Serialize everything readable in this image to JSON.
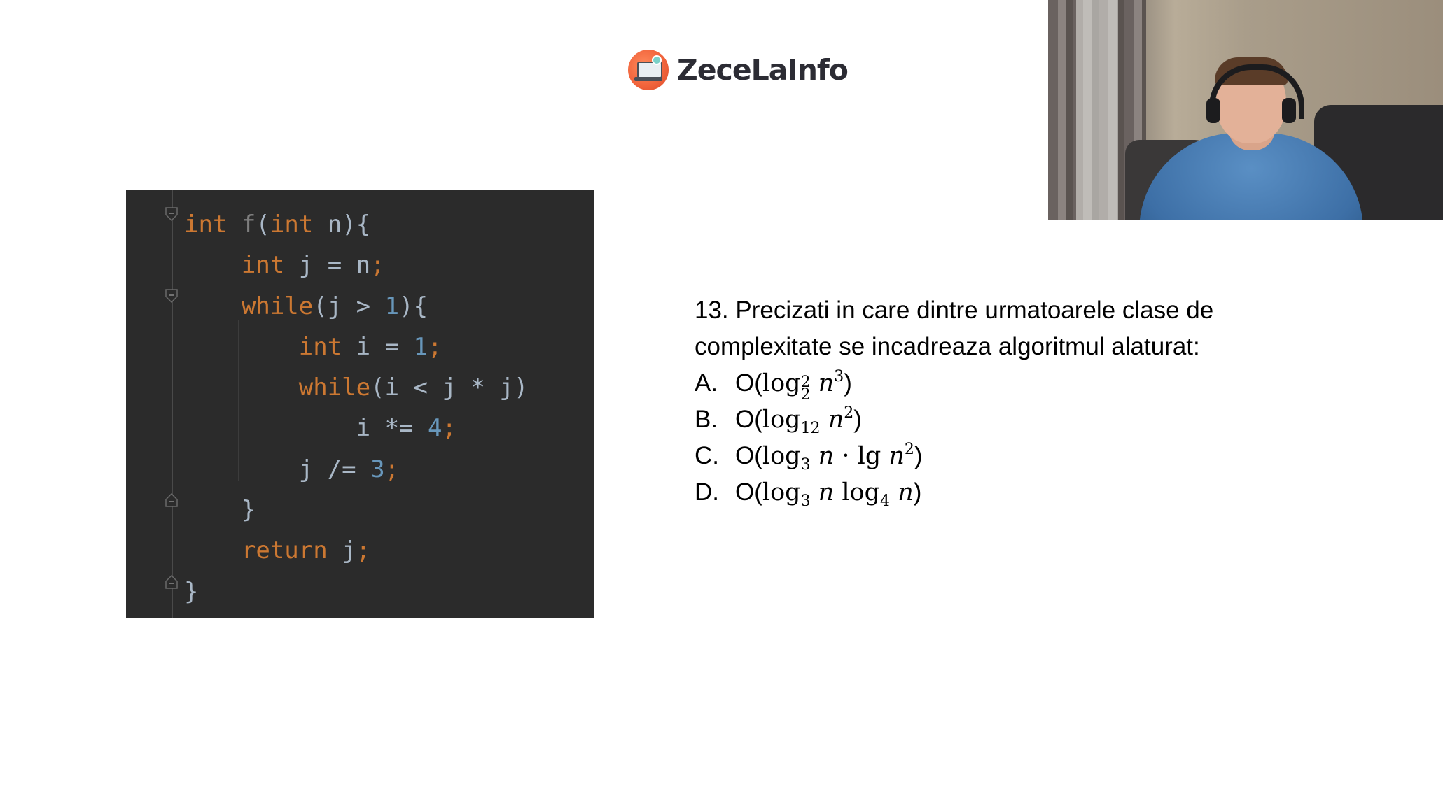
{
  "brand": {
    "name": "ZeceLaInfo"
  },
  "code": {
    "lines": [
      [
        [
          "kw",
          "int"
        ],
        [
          "id",
          " "
        ],
        [
          "fn",
          "f"
        ],
        [
          "id",
          "("
        ],
        [
          "kw",
          "int"
        ],
        [
          "id",
          " n){"
        ]
      ],
      [
        [
          "id",
          "    "
        ],
        [
          "kw",
          "int"
        ],
        [
          "id",
          " j = n"
        ],
        [
          "semi",
          ";"
        ]
      ],
      [
        [
          "id",
          "    "
        ],
        [
          "kw",
          "while"
        ],
        [
          "id",
          "(j > "
        ],
        [
          "num",
          "1"
        ],
        [
          "id",
          "){"
        ]
      ],
      [
        [
          "id",
          "        "
        ],
        [
          "kw",
          "int"
        ],
        [
          "id",
          " i = "
        ],
        [
          "num",
          "1"
        ],
        [
          "semi",
          ";"
        ]
      ],
      [
        [
          "id",
          "        "
        ],
        [
          "kw",
          "while"
        ],
        [
          "id",
          "(i < j * j)"
        ]
      ],
      [
        [
          "id",
          "            i *= "
        ],
        [
          "num",
          "4"
        ],
        [
          "semi",
          ";"
        ]
      ],
      [
        [
          "id",
          "        j /= "
        ],
        [
          "num",
          "3"
        ],
        [
          "semi",
          ";"
        ]
      ],
      [
        [
          "id",
          "    }"
        ]
      ],
      [
        [
          "id",
          "    "
        ],
        [
          "kw",
          "return"
        ],
        [
          "id",
          " j"
        ],
        [
          "semi",
          ";"
        ]
      ],
      [
        [
          "id",
          "}"
        ]
      ]
    ]
  },
  "question": {
    "line1": "13. Precizati in care dintre urmatoarele clase de",
    "line2": "complexitate se incadreaza algoritmul alaturat:",
    "options": {
      "a": {
        "letter": "A.",
        "prefix": "O(",
        "log": "log",
        "sup": "2",
        "sub": "2",
        "var": "n",
        "exp": "3",
        "suffix": ")"
      },
      "b": {
        "letter": "B.",
        "prefix": "O(",
        "log": "log",
        "sub": "12",
        "var": "n",
        "exp": "2",
        "suffix": ")"
      },
      "c": {
        "letter": "C.",
        "prefix": "O(",
        "log": "log",
        "sub": "3",
        "var": "n",
        "dot": " · lg ",
        "var2": "n",
        "exp": "2",
        "suffix": ")"
      },
      "d": {
        "letter": "D.",
        "prefix": "O(",
        "log": "log",
        "sub": "3",
        "var": "n",
        "log2": " log",
        "sub2": "4",
        "var2": "n",
        "suffix": ")"
      }
    }
  },
  "colors": {
    "code_bg": "#2b2b2b",
    "keyword": "#cc7832",
    "number": "#6897bb",
    "identifier": "#a9b7c6"
  },
  "webcam": {
    "icon": "presenter-video"
  }
}
